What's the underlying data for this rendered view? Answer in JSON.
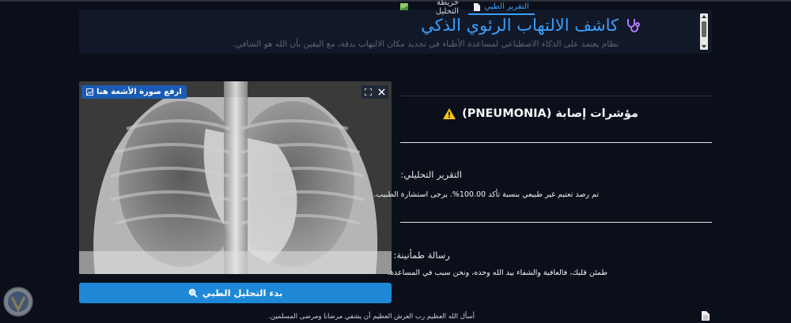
{
  "header": {
    "title": "كاشف الالتهاب الرئوي الذكي",
    "subtitle": "نظام يعتمد على الذكاء الاصطناعي لمساعدة الأطباء في تحديد مكان الالتهاب بدقة، مع اليقين بأن الله هو الشافي."
  },
  "image_panel": {
    "upload_label": "ارفع صورة الأشعة هنا",
    "analyze_button": "بدء التحليل الطبي"
  },
  "tabs": [
    {
      "label": "التقرير الطبي",
      "icon": "document-icon",
      "active": true
    },
    {
      "label": "خريطة التحليل",
      "icon": "image-icon",
      "active": false
    }
  ],
  "result": {
    "title": "مؤشرات إصابة (PNEUMONIA)",
    "warning_icon": "warning-icon"
  },
  "report": {
    "heading": "التقرير التحليلي:",
    "body": "تم رصد تعتيم غير طبيعي بنسبة تأكد 100.00%. يرجى استشارة الطبيب."
  },
  "reassurance": {
    "heading": "رسالة طمأنينة:",
    "body": "طمئن قلبك، فالعافية والشفاء بيد الله وحده، ونحن سبب في المساعدة."
  },
  "footer": {
    "text": "أسأل الله العظيم رب العرش العظيم أن يشفي مرضانا ومرضى المسلمين."
  },
  "colors": {
    "background": "#0b0f19",
    "accent": "#3aa0ff",
    "button": "#1e88d6",
    "warning": "#f5c518"
  }
}
